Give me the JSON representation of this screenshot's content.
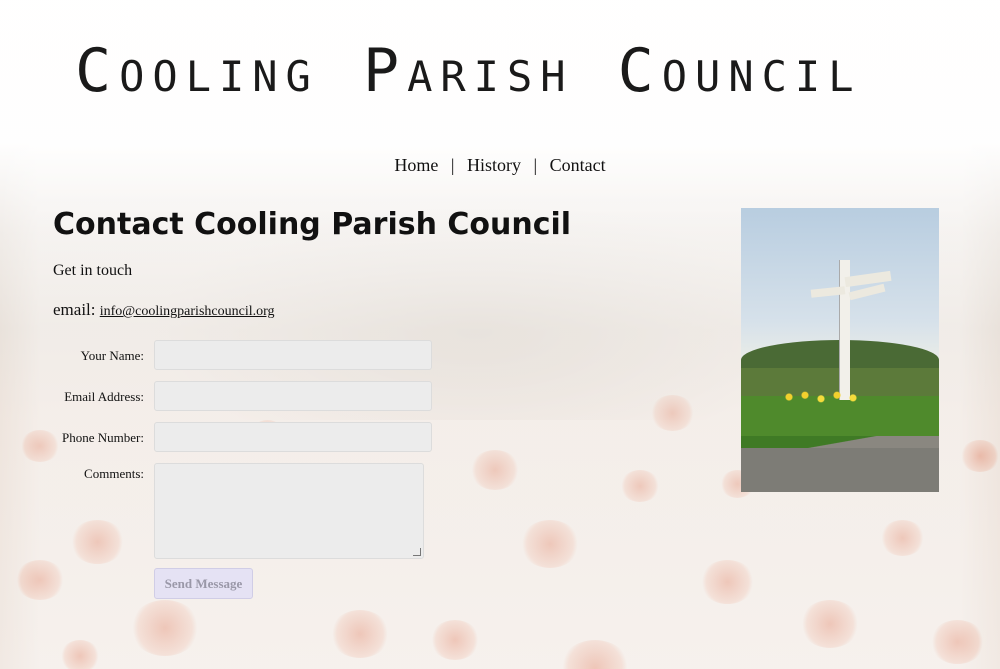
{
  "site": {
    "logo_text": "Cooling Parish Council"
  },
  "nav": {
    "items": [
      {
        "label": "Home"
      },
      {
        "label": "History"
      },
      {
        "label": "Contact"
      }
    ],
    "separator": "|"
  },
  "main": {
    "title": "Contact Cooling Parish Council",
    "intro": "Get in touch",
    "email_label": "email:",
    "email_value": "info@coolingparishcouncil.org"
  },
  "form": {
    "fields": [
      {
        "label": "Your Name:",
        "value": ""
      },
      {
        "label": "Email Address:",
        "value": ""
      },
      {
        "label": "Phone Number:",
        "value": ""
      },
      {
        "label": "Comments:",
        "value": ""
      }
    ],
    "submit_label": "Send Message"
  },
  "photo": {
    "subject": "signpost-photo"
  },
  "colors": {
    "field_bg": "#ececec",
    "button_bg": "#e5e2f4",
    "button_text": "#9a98a8",
    "poppy": "#e8603a"
  }
}
